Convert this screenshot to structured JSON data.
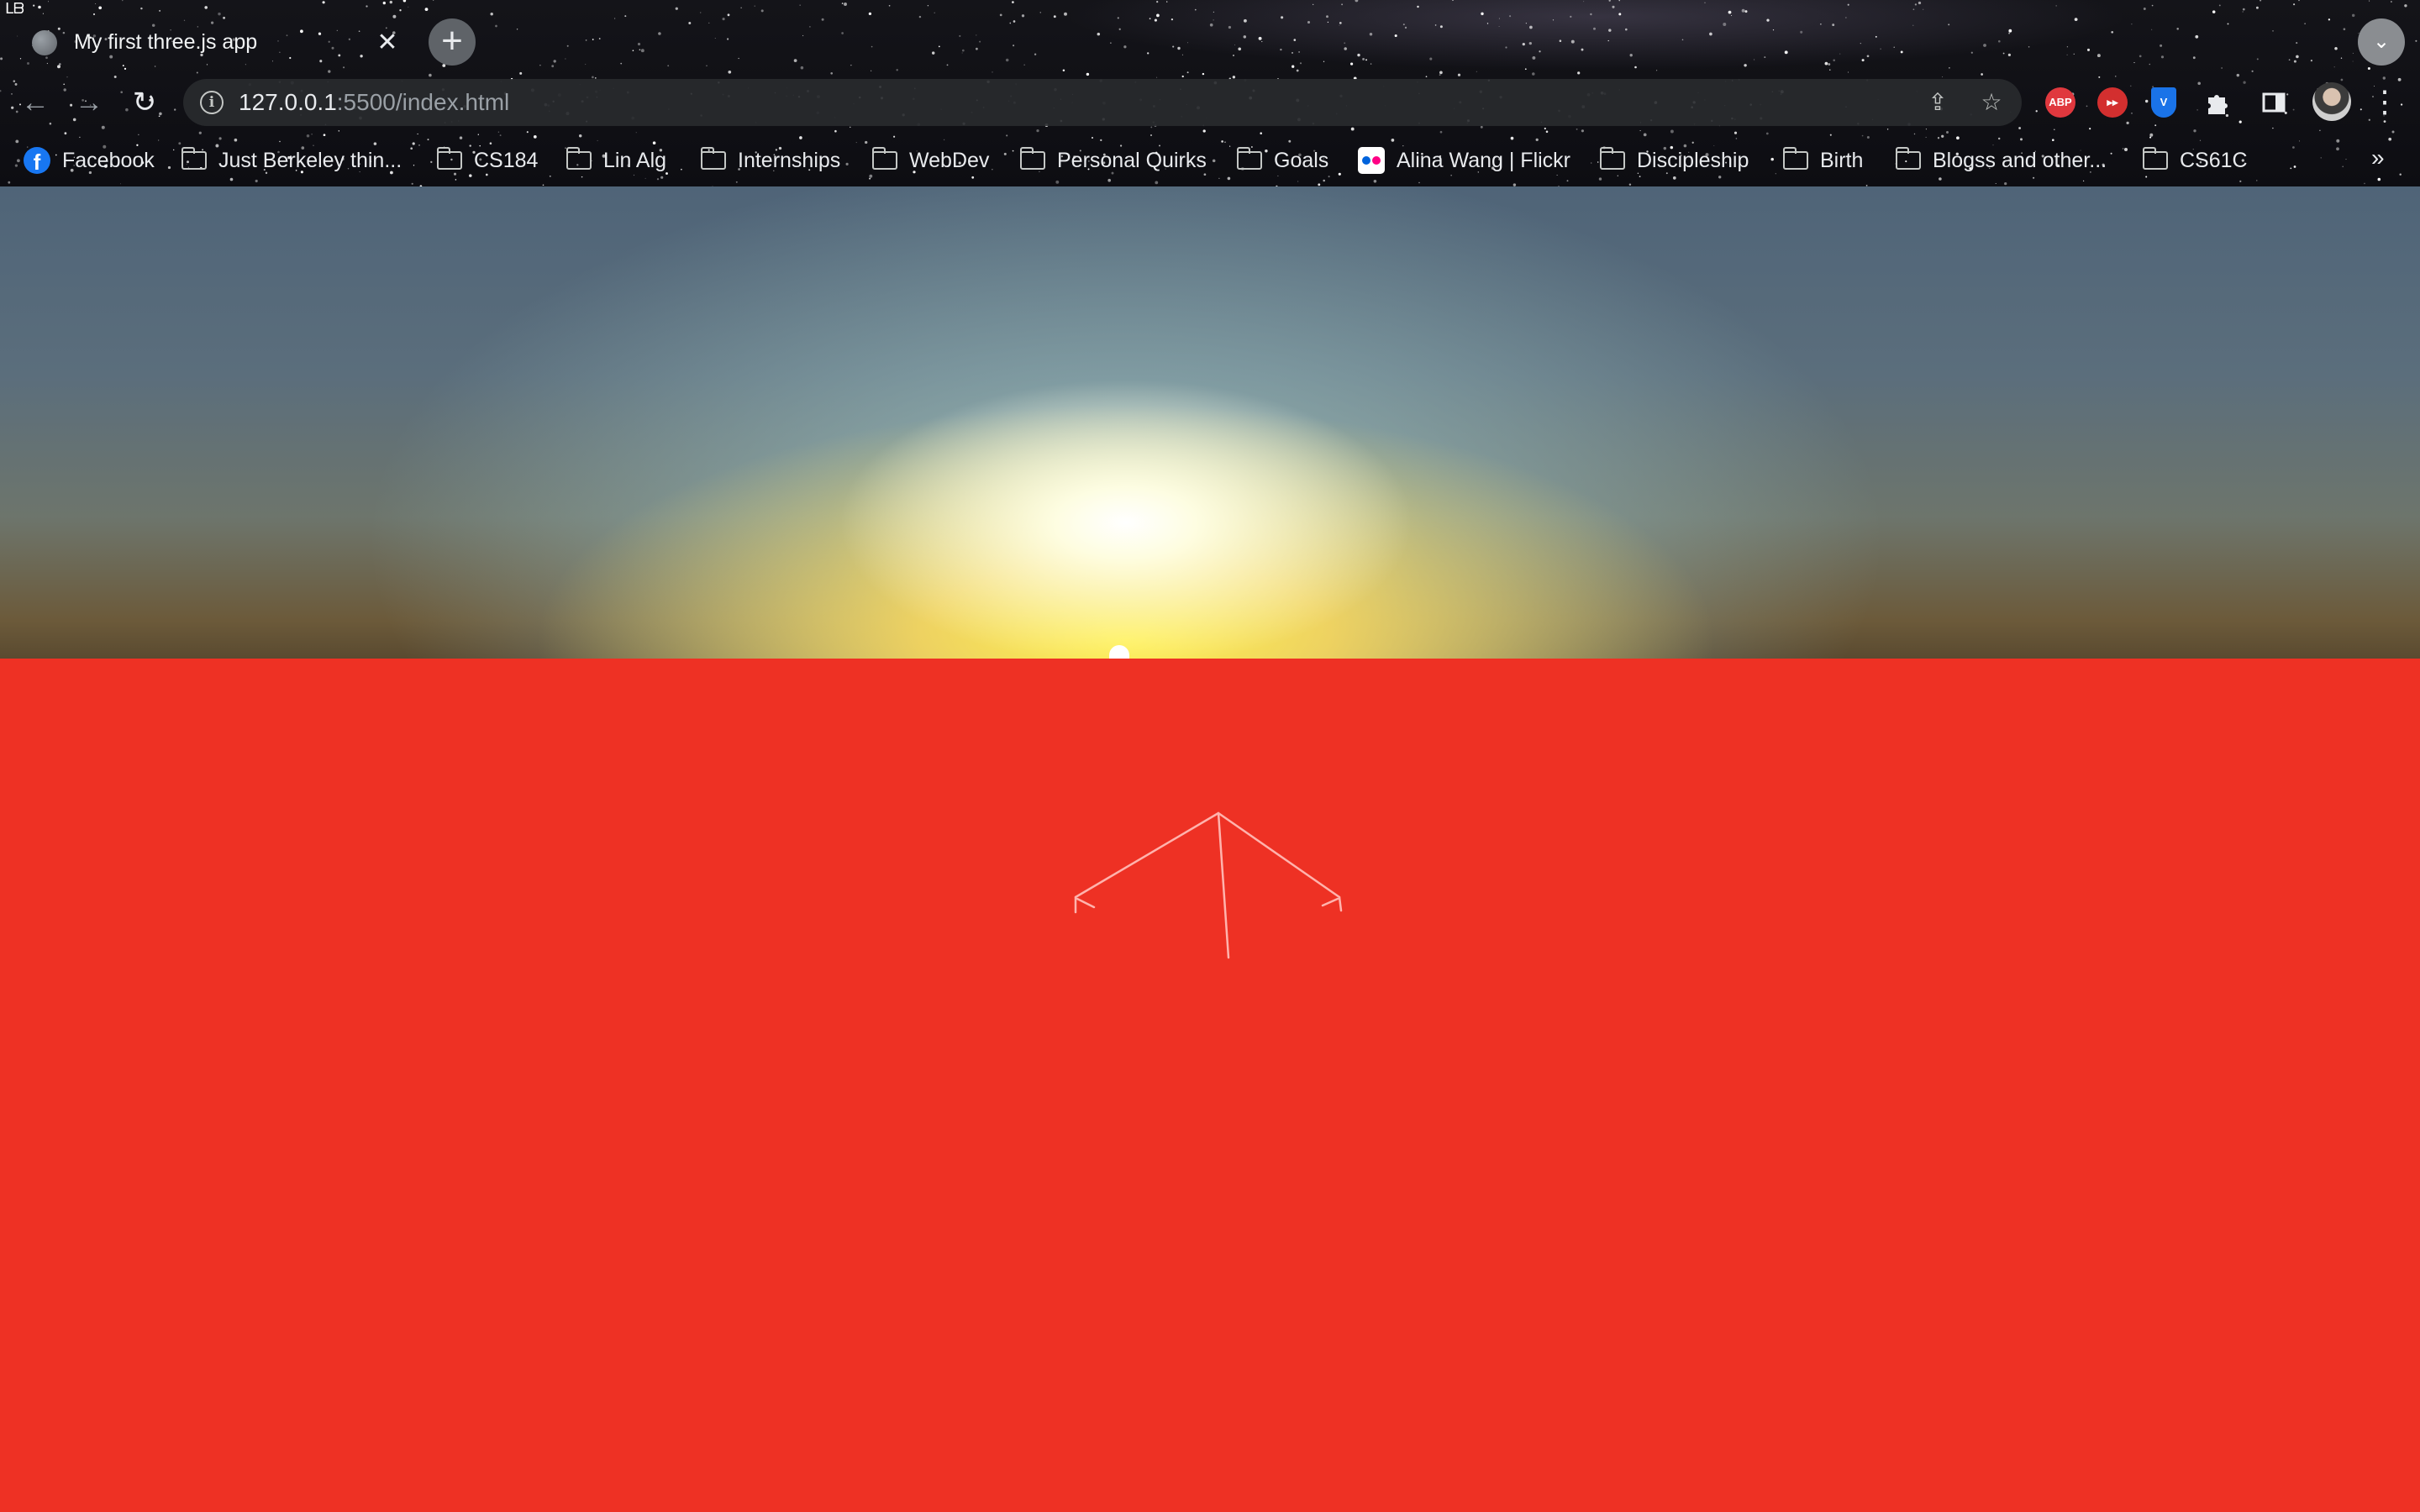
{
  "tab": {
    "title": "My first three.js app",
    "close_glyph": "✕",
    "new_tab_glyph": "+",
    "corner_mark": "ᒪᗷ"
  },
  "toolbar": {
    "back_glyph": "←",
    "forward_glyph": "→",
    "reload_glyph": "↻",
    "info_glyph": "i",
    "url_host": "127.0.0.1",
    "url_rest": ":5500/index.html",
    "share_glyph": "⇪",
    "star_glyph": "☆",
    "menu_glyph": "⋮",
    "tab_search_glyph": "⌄"
  },
  "extensions": [
    {
      "name": "adblock-plus-icon",
      "label": "ABP",
      "color": "#e0383e"
    },
    {
      "name": "video-speed-icon",
      "label": "▸▸",
      "color": "#d32f2f"
    },
    {
      "name": "shield-icon",
      "label": "V",
      "color": "#1a73e8"
    }
  ],
  "bookmarks": [
    {
      "label": "Facebook",
      "icon": "facebook-icon"
    },
    {
      "label": "Just Berkeley thin...",
      "icon": "folder-icon"
    },
    {
      "label": "CS184",
      "icon": "folder-icon"
    },
    {
      "label": "Lin Alg",
      "icon": "folder-icon"
    },
    {
      "label": "Internships",
      "icon": "folder-icon"
    },
    {
      "label": "WebDev",
      "icon": "folder-icon"
    },
    {
      "label": "Personal Quirks",
      "icon": "folder-icon"
    },
    {
      "label": "Goals",
      "icon": "folder-icon"
    },
    {
      "label": "Alina Wang | Flickr",
      "icon": "flickr-icon"
    },
    {
      "label": "Discipleship",
      "icon": "folder-icon"
    },
    {
      "label": "Birth",
      "icon": "folder-icon"
    },
    {
      "label": "Blogss and other...",
      "icon": "folder-icon"
    },
    {
      "label": "CS61C",
      "icon": "folder-icon"
    }
  ],
  "bookmarks_overflow_glyph": "»",
  "scene": {
    "ground_color": "#ee3124",
    "wireframe_color": "#ffb3ad"
  }
}
